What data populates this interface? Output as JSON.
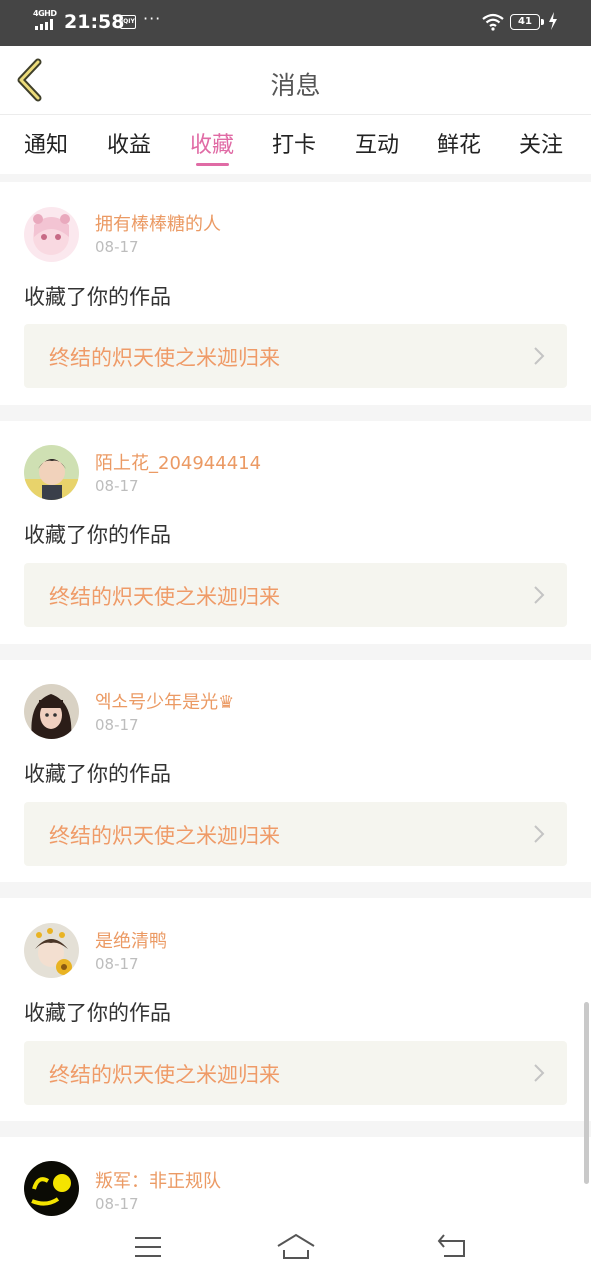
{
  "status_bar": {
    "network": "4GHD",
    "time": "21:58",
    "app_badge": "iQIY",
    "dots": "···",
    "battery": "41"
  },
  "header": {
    "title": "消息"
  },
  "tabs": [
    {
      "label": "通知",
      "active": false
    },
    {
      "label": "收益",
      "active": false
    },
    {
      "label": "收藏",
      "active": true
    },
    {
      "label": "打卡",
      "active": false
    },
    {
      "label": "互动",
      "active": false
    },
    {
      "label": "鲜花",
      "active": false
    },
    {
      "label": "关注",
      "active": false
    }
  ],
  "messages": [
    {
      "username": "拥有棒棒糖的人",
      "date": "08-17",
      "action": "收藏了你的作品",
      "work_title": "终结的炽天使之米迦归来"
    },
    {
      "username": "陌上花_204944414",
      "date": "08-17",
      "action": "收藏了你的作品",
      "work_title": "终结的炽天使之米迦归来"
    },
    {
      "username": "엑소号少年是光♛",
      "date": "08-17",
      "action": "收藏了你的作品",
      "work_title": "终结的炽天使之米迦归来"
    },
    {
      "username": "是绝清鸭",
      "date": "08-17",
      "action": "收藏了你的作品",
      "work_title": "终结的炽天使之米迦归来"
    },
    {
      "username": "叛军：非正规队",
      "date": "08-17"
    }
  ],
  "colors": {
    "accent": "#e06ba5",
    "username": "#eb9a64",
    "work_title": "#ef9b68",
    "work_box_bg": "#f5f5ef"
  }
}
